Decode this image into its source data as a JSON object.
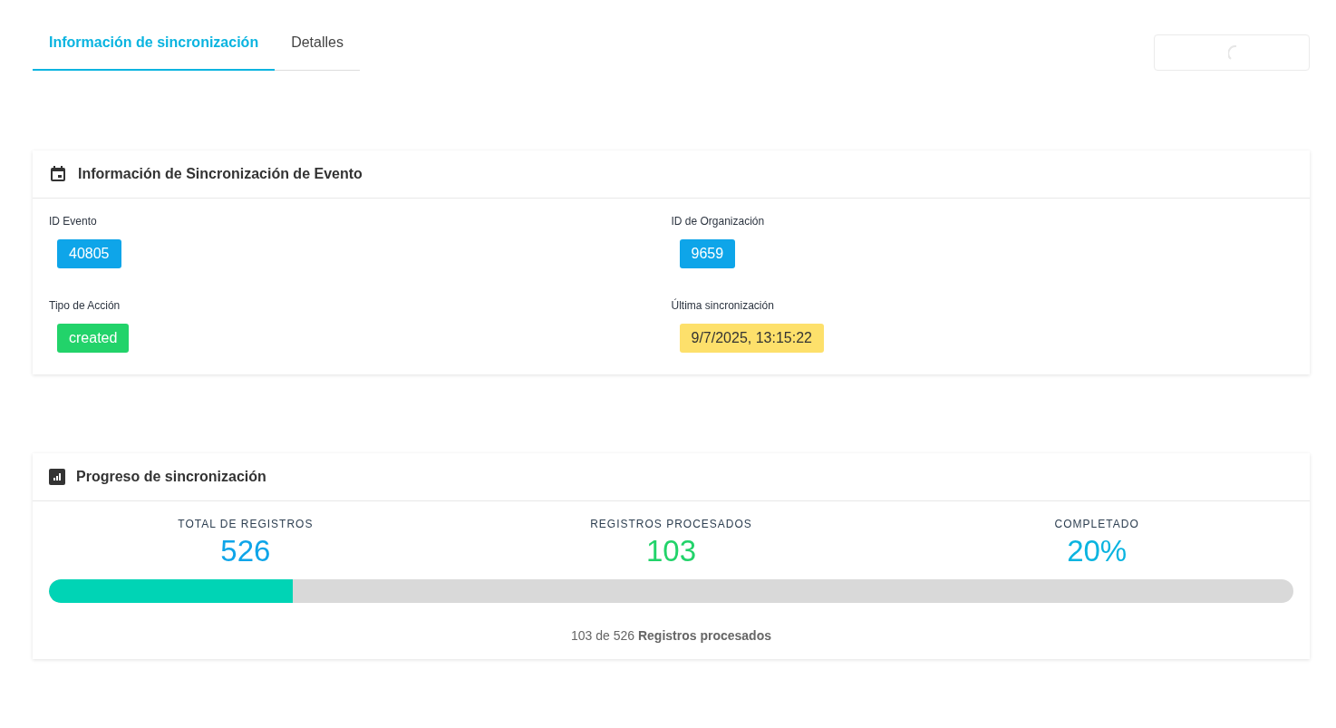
{
  "tabs": [
    {
      "label": "Información de sincronización",
      "selected": true
    },
    {
      "label": "Detalles",
      "selected": false
    }
  ],
  "loading_button": {
    "loading": true
  },
  "event_card": {
    "title": "Información de Sincronización de Evento",
    "fields": [
      {
        "label": "ID Evento",
        "value": "40805",
        "color": "#0ea5e9"
      },
      {
        "label": "ID de Organización",
        "value": "9659",
        "color": "#0ea5e9"
      },
      {
        "label": "Tipo de Acción",
        "value": "created",
        "color": "#22d36a"
      },
      {
        "label": "Última sincronización",
        "value": "9/7/2025, 13:15:22",
        "color": "#fde06b"
      }
    ]
  },
  "progress_card": {
    "title": "Progreso de sincronización",
    "stats": [
      {
        "label": "TOTAL DE REGISTROS",
        "value": "526",
        "color": "#0ea5e9"
      },
      {
        "label": "REGISTROS PROCESADOS",
        "value": "103",
        "color": "#22d36a"
      },
      {
        "label": "COMPLETADO",
        "value": "20%",
        "color": "#0ab4e0"
      }
    ],
    "level": 0.196,
    "summary": "103 de 526 **Registros procesados**"
  }
}
